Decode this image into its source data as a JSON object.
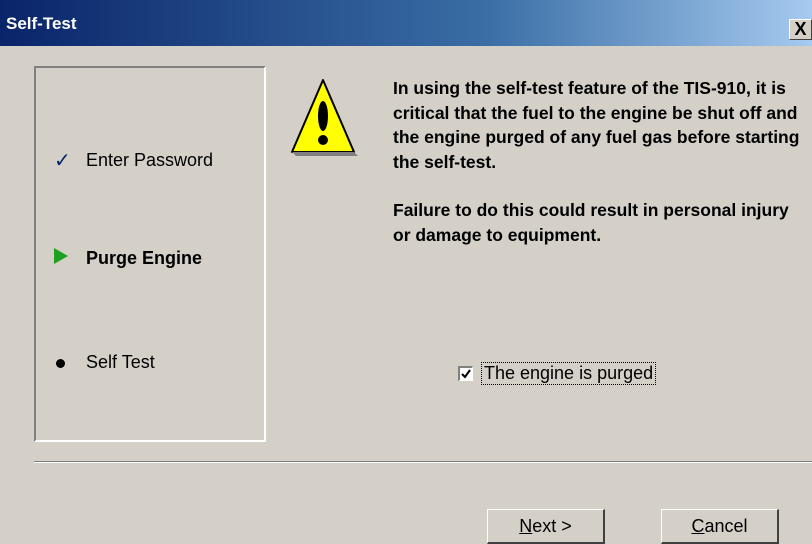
{
  "window": {
    "title": "Self-Test",
    "close_label": "X"
  },
  "steps": [
    {
      "label": "Enter Password",
      "state": "done",
      "icon": "check-icon"
    },
    {
      "label": "Purge Engine",
      "state": "current",
      "icon": "play-arrow-icon"
    },
    {
      "label": "Self Test",
      "state": "pending",
      "icon": "bullet-icon"
    }
  ],
  "warning": {
    "icon": "warning-icon",
    "paragraph1": "In using the self-test feature of the TIS-910, it is critical that the fuel to the engine be shut off and the engine purged of any fuel gas before starting the self-test.",
    "paragraph2": "Failure to do this could result in personal injury or damage to equipment."
  },
  "confirm": {
    "label": "The engine is purged",
    "checked": true
  },
  "buttons": {
    "next_mnemonic": "N",
    "next_rest": "ext >",
    "cancel_mnemonic": "C",
    "cancel_rest": "ancel"
  },
  "colors": {
    "title_bar": "#0a246a",
    "face": "#d4d0c8",
    "current_arrow": "#1fa01f",
    "warning_fill": "#ffff00"
  }
}
